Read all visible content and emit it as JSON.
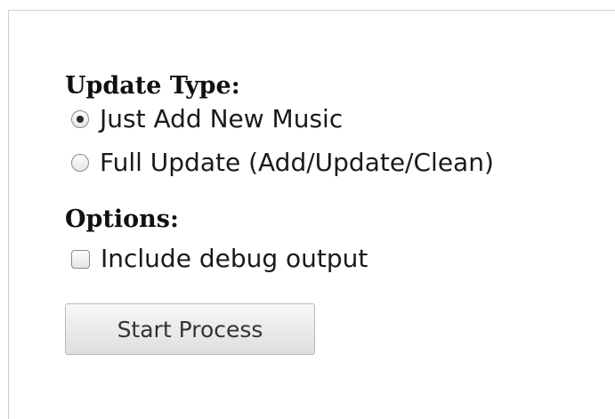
{
  "update_type": {
    "heading": "Update Type:",
    "options": [
      {
        "label": "Just Add New Music",
        "selected": true
      },
      {
        "label": "Full Update (Add/Update/Clean)",
        "selected": false
      }
    ]
  },
  "options_section": {
    "heading": "Options:",
    "debug_checkbox": {
      "label": "Include debug output",
      "checked": false
    }
  },
  "actions": {
    "start_label": "Start Process"
  }
}
